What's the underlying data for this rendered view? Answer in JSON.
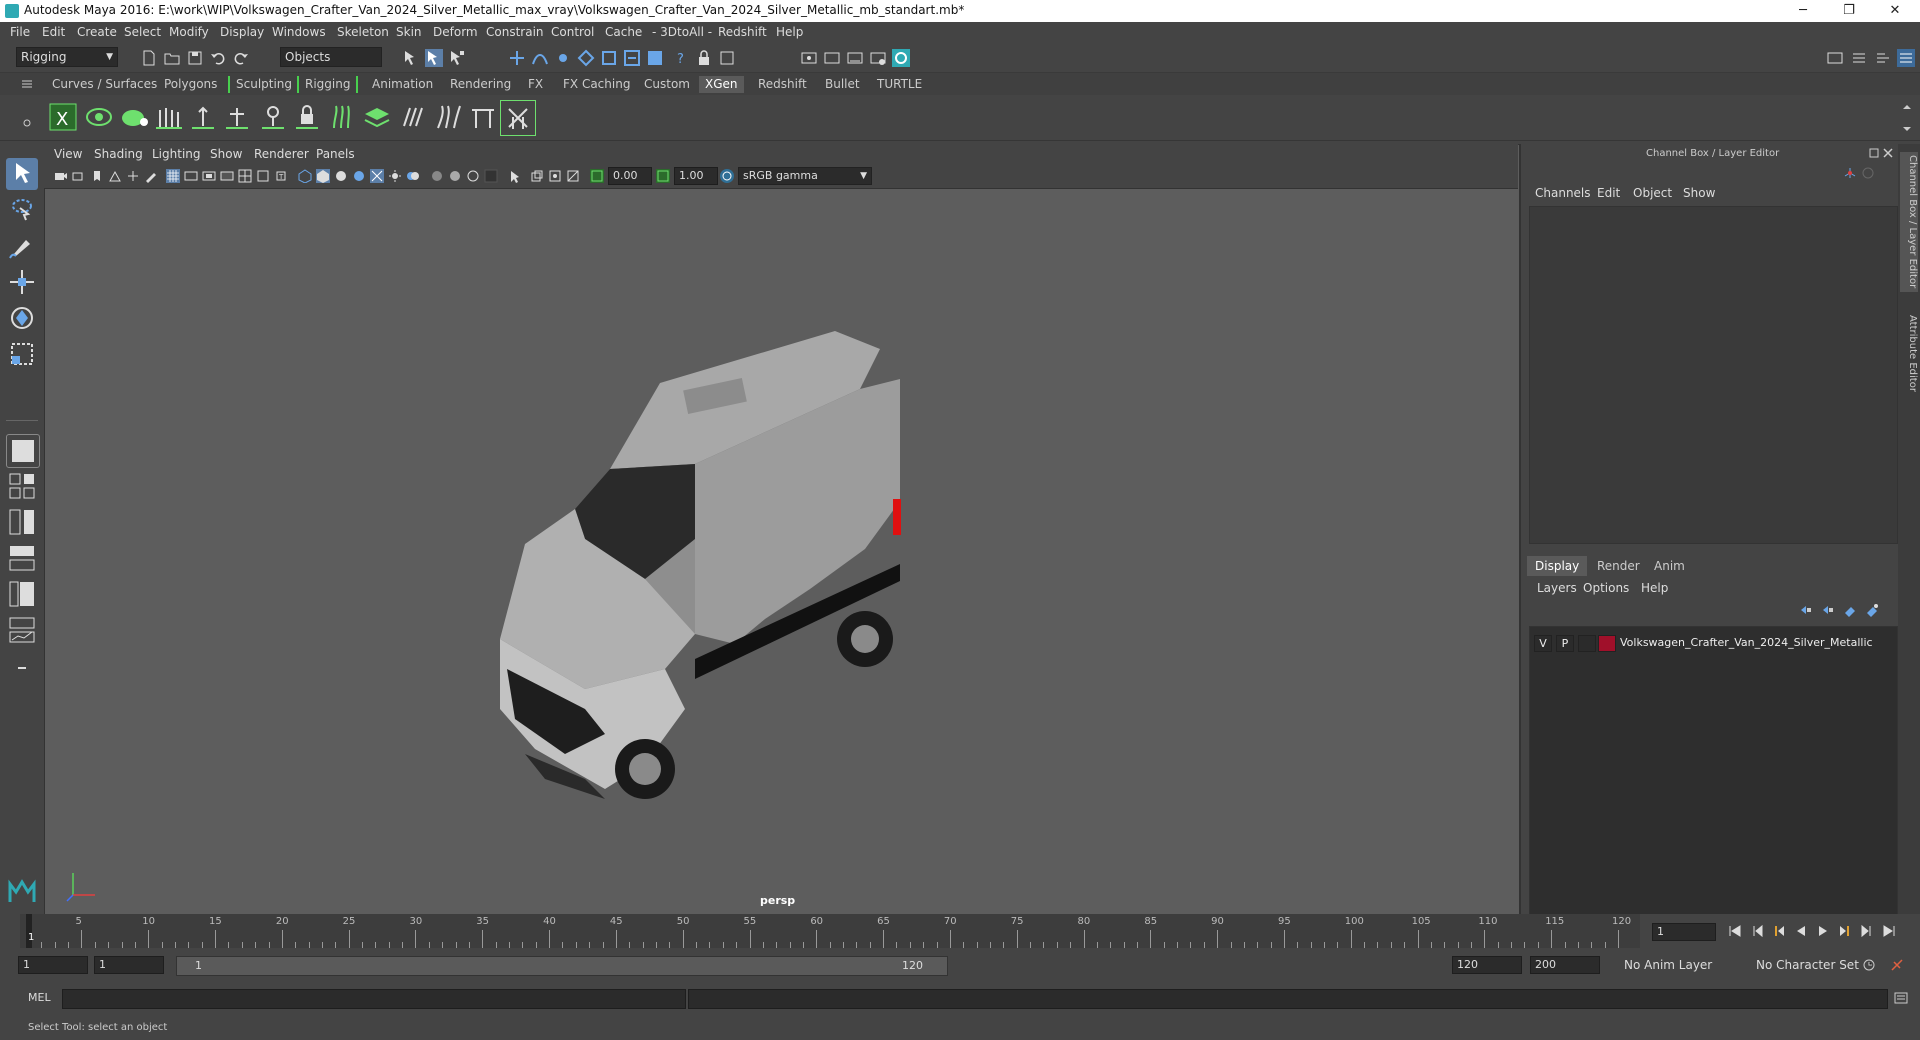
{
  "window": {
    "title": "Autodesk Maya 2016: E:\\work\\WIP\\Volkswagen_Crafter_Van_2024_Silver_Metallic_max_vray\\Volkswagen_Crafter_Van_2024_Silver_Metallic_mb_standart.mb*",
    "minimize": "─",
    "restore": "❐",
    "close": "✕"
  },
  "menubar": [
    "File",
    "Edit",
    "Create",
    "Select",
    "Modify",
    "Display",
    "Windows",
    "Skeleton",
    "Skin",
    "Deform",
    "Constrain",
    "Control",
    "Cache",
    "- 3DtoAll -",
    "Redshift",
    "Help"
  ],
  "statusline": {
    "menuset": "Rigging",
    "selection_mode": "Objects"
  },
  "shelf_tabs": [
    "Curves / Surfaces",
    "Polygons",
    "Sculpting",
    "Rigging",
    "Animation",
    "Rendering",
    "FX",
    "FX Caching",
    "Custom",
    "XGen",
    "Redshift",
    "Bullet",
    "TURTLE"
  ],
  "active_shelf_tab": "XGen",
  "viewport": {
    "menus": [
      "View",
      "Shading",
      "Lighting",
      "Show",
      "Renderer",
      "Panels"
    ],
    "exposure": "0.00",
    "gamma": "1.00",
    "color_space": "sRGB gamma",
    "camera": "persp"
  },
  "channel_box": {
    "header": "Channel Box / Layer Editor",
    "menus": [
      "Channels",
      "Edit",
      "Object",
      "Show"
    ]
  },
  "layer_editor": {
    "tabs": [
      "Display",
      "Render",
      "Anim"
    ],
    "active_tab": "Display",
    "menus": [
      "Layers",
      "Options",
      "Help"
    ],
    "layers": [
      {
        "v": "V",
        "p": "P",
        "color": "#a0102a",
        "name": "Volkswagen_Crafter_Van_2024_Silver_Metallic"
      }
    ]
  },
  "side_tabs": [
    "Channel Box / Layer Editor",
    "Attribute Editor"
  ],
  "timeline": {
    "ticks": [
      "5",
      "10",
      "15",
      "20",
      "25",
      "30",
      "35",
      "40",
      "45",
      "50",
      "55",
      "60",
      "65",
      "70",
      "75",
      "80",
      "85",
      "90",
      "95",
      "100",
      "105",
      "110",
      "115",
      "120"
    ],
    "first_frame_label": "1",
    "current_frame": "1"
  },
  "range": {
    "start": "1",
    "playback_start": "1",
    "slider_start": "1",
    "slider_end": "120",
    "playback_end": "120",
    "end": "200",
    "anim_layer": "No Anim Layer",
    "character_set": "No Character Set"
  },
  "command_line": {
    "label": "MEL"
  },
  "help_line": "Select Tool: select an object"
}
